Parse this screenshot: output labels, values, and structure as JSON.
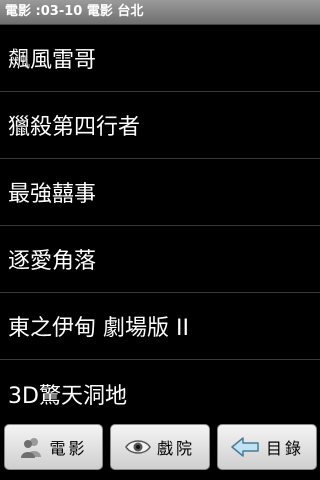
{
  "status_bar": {
    "title": "電影 :03-10 電影 台北"
  },
  "movies": [
    {
      "title": "飆風雷哥"
    },
    {
      "title": "獵殺第四行者"
    },
    {
      "title": "最強囍事"
    },
    {
      "title": "逐愛角落"
    },
    {
      "title": "東之伊甸 劇場版 II"
    },
    {
      "title": "3D驚天洞地"
    }
  ],
  "toolbar": {
    "movies_label": "電影",
    "theaters_label": "戲院",
    "menu_label": "目錄",
    "movies_icon": "people-icon",
    "theaters_icon": "eye-icon",
    "menu_icon": "left-arrow-icon"
  },
  "colors": {
    "background": "#000000",
    "divider": "#3a3a3a",
    "title_bar": "#808080",
    "button": "#e6e6e6"
  }
}
